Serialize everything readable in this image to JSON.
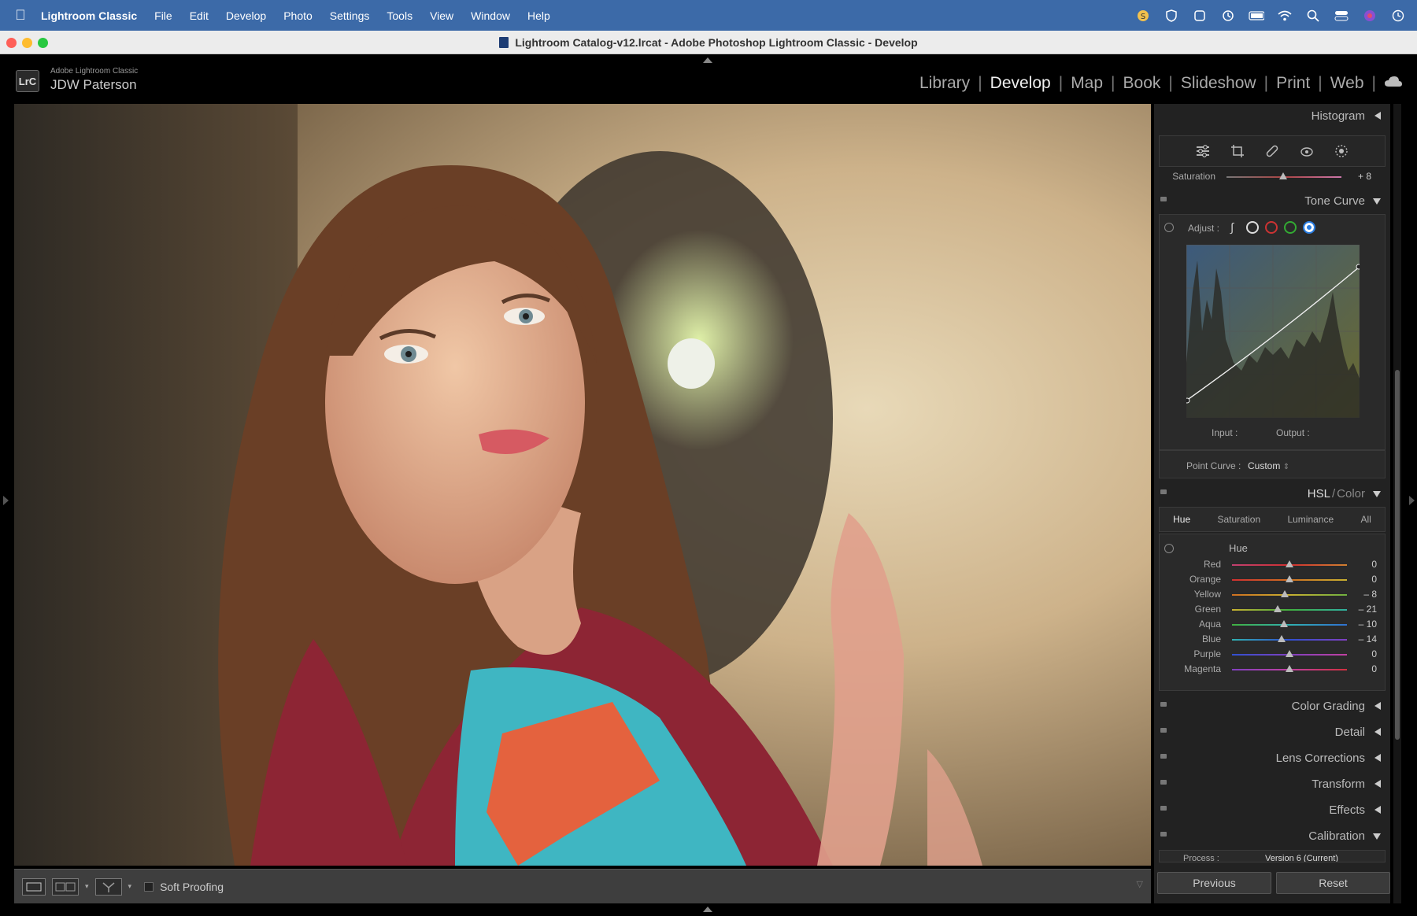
{
  "menubar": {
    "app_name": "Lightroom Classic",
    "items": [
      "File",
      "Edit",
      "Develop",
      "Photo",
      "Settings",
      "Tools",
      "View",
      "Window",
      "Help"
    ]
  },
  "window": {
    "title": "Lightroom Catalog-v12.lrcat - Adobe Photoshop Lightroom Classic - Develop"
  },
  "identity": {
    "logo": "LrC",
    "product": "Adobe Lightroom Classic",
    "user": "JDW Paterson"
  },
  "modules": [
    "Library",
    "Develop",
    "Map",
    "Book",
    "Slideshow",
    "Print",
    "Web"
  ],
  "active_module": "Develop",
  "panels": {
    "histogram": "Histogram",
    "saturation_label": "Saturation",
    "saturation_value": "+ 8",
    "tone_curve": "Tone Curve",
    "adjust_label": "Adjust :",
    "input_label": "Input :",
    "output_label": "Output :",
    "point_curve_label": "Point Curve :",
    "point_curve_value": "Custom",
    "hsl_title": "HSL",
    "hsl_sep": "/",
    "hsl_color": "Color",
    "hsl_tabs": [
      "Hue",
      "Saturation",
      "Luminance",
      "All"
    ],
    "hue_heading": "Hue",
    "hue_sliders": [
      {
        "label": "Red",
        "value": "0",
        "level": 0
      },
      {
        "label": "Orange",
        "value": "0",
        "level": 0
      },
      {
        "label": "Yellow",
        "value": "– 8",
        "level": -8
      },
      {
        "label": "Green",
        "value": "– 21",
        "level": -21
      },
      {
        "label": "Aqua",
        "value": "– 10",
        "level": -10
      },
      {
        "label": "Blue",
        "value": "– 14",
        "level": -14
      },
      {
        "label": "Purple",
        "value": "0",
        "level": 0
      },
      {
        "label": "Magenta",
        "value": "0",
        "level": 0
      }
    ],
    "color_grading": "Color Grading",
    "detail": "Detail",
    "lens_corrections": "Lens Corrections",
    "transform": "Transform",
    "effects": "Effects",
    "calibration": "Calibration",
    "calibration_process_label": "Process :",
    "calibration_process_value": "Version 6 (Current)"
  },
  "buttons": {
    "previous": "Previous",
    "reset": "Reset"
  },
  "toolbar": {
    "soft_proofing": "Soft Proofing"
  }
}
